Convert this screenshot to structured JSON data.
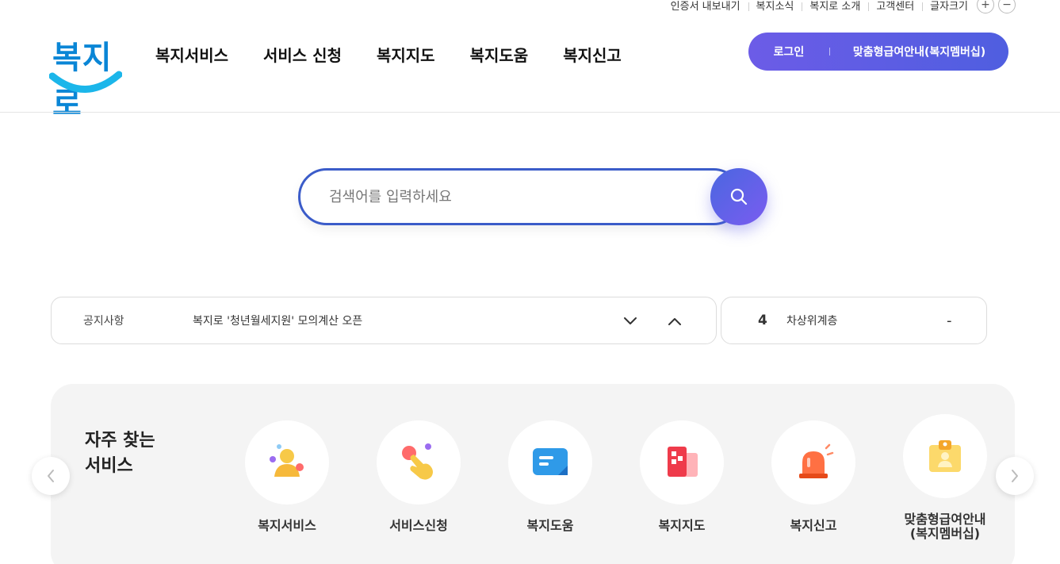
{
  "util_bar": {
    "links": [
      "인증서 내보내기",
      "복지소식",
      "복지로 소개",
      "고객센터"
    ],
    "font_size_label": "글자크기",
    "increase": "+",
    "decrease": "−"
  },
  "header": {
    "logo_text": "복지로",
    "nav": [
      "복지서비스",
      "서비스 신청",
      "복지지도",
      "복지도움",
      "복지신고"
    ],
    "login_label": "로그인",
    "membership_label": "맞춤형급여안내(복지멤버십)"
  },
  "search": {
    "placeholder": "검색어를 입력하세요",
    "value": ""
  },
  "notice": {
    "label": "공지사항",
    "text": "복지로 '청년월세지원' 모의계산 오픈"
  },
  "ranking": {
    "rank": "4",
    "keyword": "차상위계층",
    "change": "-"
  },
  "frequent": {
    "title_line1": "자주 찾는",
    "title_line2": "서비스",
    "items": [
      {
        "label": "복지서비스",
        "icon": "person-icon"
      },
      {
        "label": "서비스신청",
        "icon": "hand-pointer-icon"
      },
      {
        "label": "복지도움",
        "icon": "chat-bubble-icon"
      },
      {
        "label": "복지지도",
        "icon": "map-icon"
      },
      {
        "label": "복지신고",
        "icon": "siren-icon"
      },
      {
        "label": "맞춤형급여안내\n(복지멤버십)",
        "label_line1": "맞춤형급여안내",
        "label_line2": "(복지멤버십)",
        "icon": "id-badge-icon"
      }
    ]
  },
  "colors": {
    "brand_blue": "#3b5cc9",
    "pill_purple": "#6c5ce7",
    "logo_cyan": "#1bb6ea"
  }
}
